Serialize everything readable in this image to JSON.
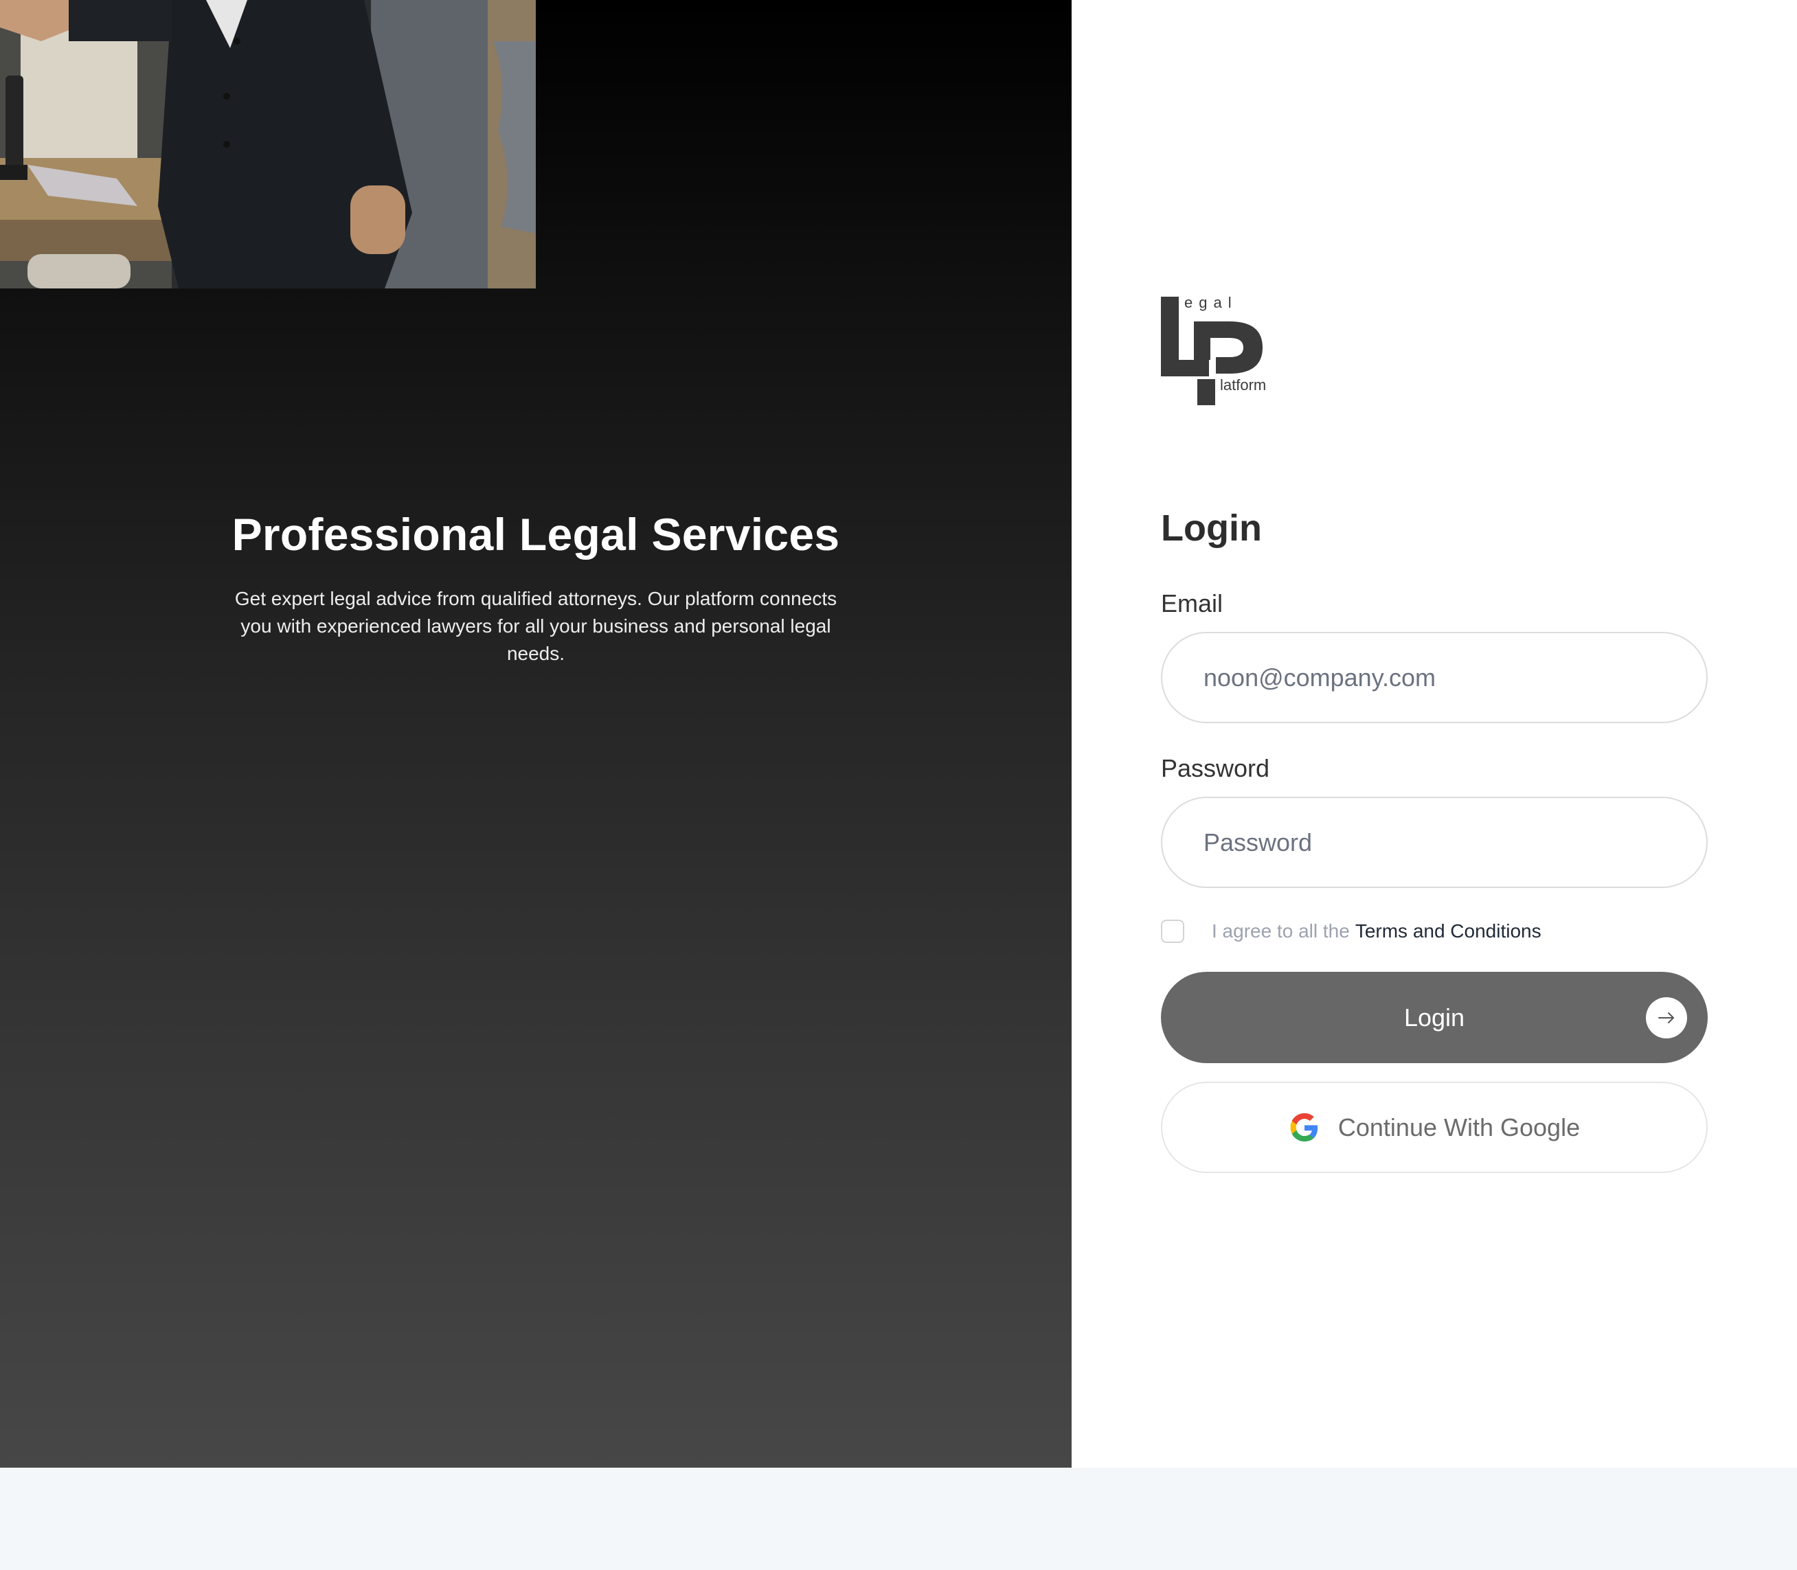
{
  "hero": {
    "title": "Professional Legal Services",
    "subtitle": "Get expert legal advice from qualified attorneys. Our platform connects you with experienced lawyers for all your business and personal legal needs."
  },
  "logo": {
    "top_text": "egal",
    "side_text": "latform"
  },
  "login": {
    "title": "Login",
    "email_label": "Email",
    "email_placeholder": "noon@company.com",
    "password_label": "Password",
    "password_placeholder": "Password",
    "terms_prefix": "I agree to all the",
    "terms_link": "Terms and Conditions",
    "login_button": "Login",
    "google_button": "Continue With Google"
  },
  "icons": {
    "arrow": "arrow-right-icon",
    "google": "google-icon"
  },
  "colors": {
    "login_button": "#676767",
    "panel_dark_top": "#000000",
    "panel_dark_bottom": "#474747",
    "footer_bg": "#f4f7fa"
  }
}
